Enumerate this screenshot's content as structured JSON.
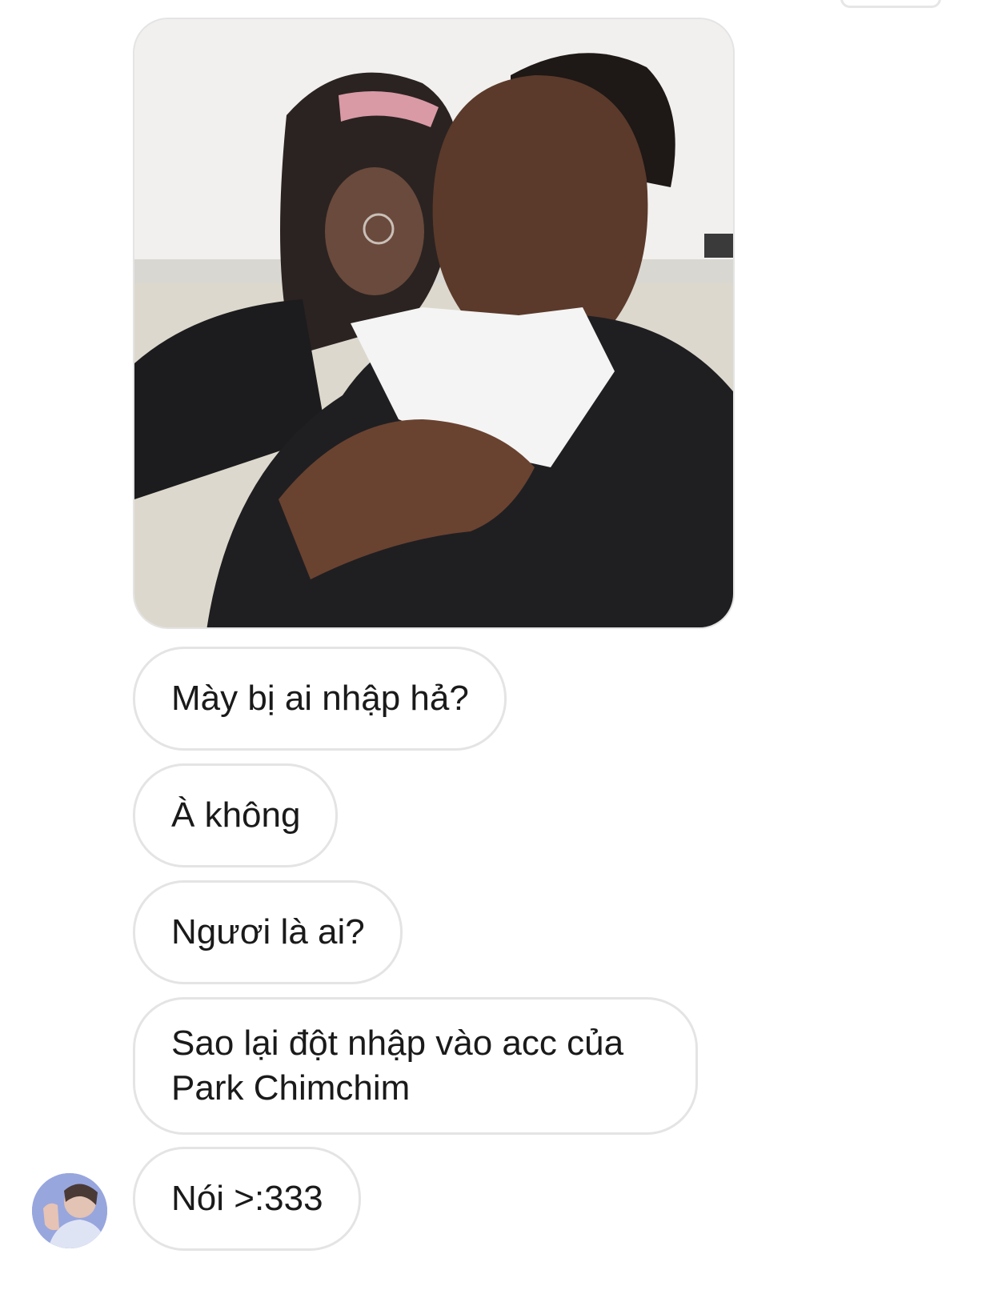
{
  "conversation": {
    "messages": [
      {
        "type": "image",
        "icon": "meme-photo"
      },
      {
        "type": "text",
        "text": "Mày bị ai nhập hả?"
      },
      {
        "type": "text",
        "text": "À không"
      },
      {
        "type": "text",
        "text": "Ngươi là ai?"
      },
      {
        "type": "text",
        "text": "Sao lại đột nhập vào acc của Park Chimchim"
      },
      {
        "type": "text",
        "text": "Nói >:333"
      }
    ],
    "sender_avatar": {
      "icon": "avatar-photo"
    }
  }
}
